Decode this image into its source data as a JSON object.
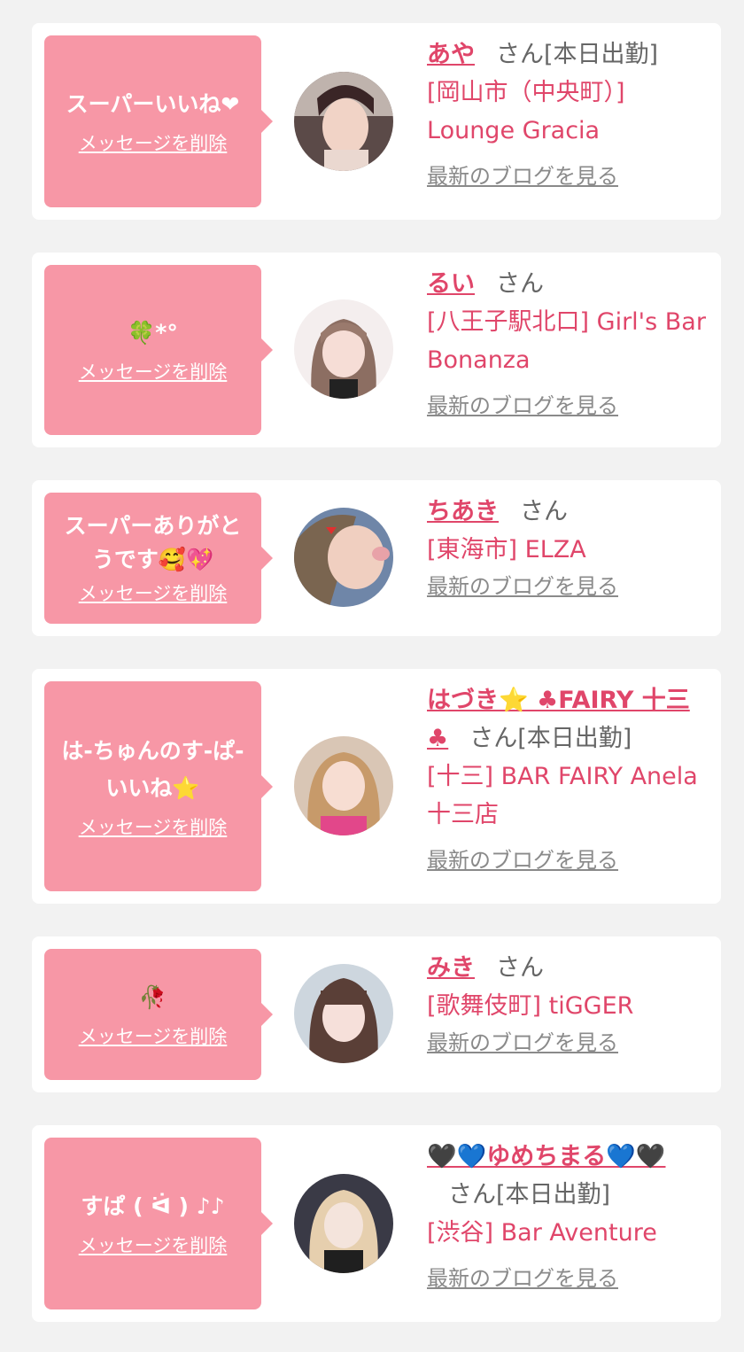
{
  "common": {
    "delete_label": "メッセージを削除",
    "san_label": "さん",
    "blog_label": "最新のブログを見る"
  },
  "items": [
    {
      "message": "スーパーいいね❤",
      "name": "あや",
      "status": "[本日出勤]",
      "shop": "[岡山市（中央町）] Lounge Gracia"
    },
    {
      "message": "🍀*°",
      "name": "るい",
      "status": "",
      "shop": "[八王子駅北口] Girl's Bar Bonanza"
    },
    {
      "message": "スーパーありがとうです🥰💖",
      "name": "ちあき",
      "status": "",
      "shop": "[東海市] ELZA"
    },
    {
      "message": "は-ちゅんのす-ぱ-いいね⭐",
      "name": "はづき⭐ ♣FAIRY 十三♣",
      "status": "[本日出勤]",
      "shop": "[十三] BAR FAIRY Anela 十三店"
    },
    {
      "message": "🥀",
      "name": "みき",
      "status": "",
      "shop": "[歌舞伎町] tiGGER"
    },
    {
      "message": "すぱ ( ᐛ ) ♪♪",
      "name": "🖤💙ゆめちまる💙🖤",
      "status": "[本日出勤]",
      "shop": "[渋谷] Bar Aventure"
    }
  ],
  "colors": {
    "accent": "#e0466a",
    "bubble": "#f797a6",
    "background": "#f2f2f2"
  }
}
